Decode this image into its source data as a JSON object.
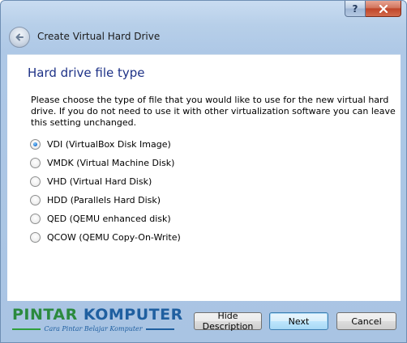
{
  "window": {
    "help_label": "?",
    "close_label": "✕"
  },
  "wizard": {
    "title": "Create Virtual Hard Drive",
    "back_icon": "back-arrow-icon"
  },
  "page": {
    "heading": "Hard drive file type",
    "description": "Please choose the type of file that you would like to use for the new virtual hard drive. If you do not need to use it with other virtualization software you can leave this setting unchanged."
  },
  "options": [
    {
      "label": "VDI (VirtualBox Disk Image)",
      "selected": true
    },
    {
      "label": "VMDK (Virtual Machine Disk)",
      "selected": false
    },
    {
      "label": "VHD (Virtual Hard Disk)",
      "selected": false
    },
    {
      "label": "HDD (Parallels Hard Disk)",
      "selected": false
    },
    {
      "label": "QED (QEMU enhanced disk)",
      "selected": false
    },
    {
      "label": "QCOW (QEMU Copy-On-Write)",
      "selected": false
    }
  ],
  "brand": {
    "word1": "PINTAR",
    "word2": "KOMPUTER",
    "tagline": "Cara Pintar Belajar Komputer",
    "colors": {
      "word1": "#2b8a3e",
      "word2": "#1f5fa0"
    }
  },
  "buttons": {
    "hide_description": "Hide Description",
    "next": "Next",
    "cancel": "Cancel"
  }
}
